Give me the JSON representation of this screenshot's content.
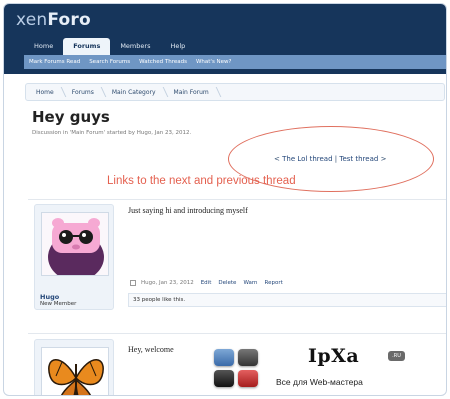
{
  "header": {
    "logo_light": "xen",
    "logo_bold": "Foro"
  },
  "nav": {
    "tabs": [
      "Home",
      "Forums",
      "Members",
      "Help"
    ],
    "active_tab": "Forums"
  },
  "subnav": {
    "items": [
      "Mark Forums Read",
      "Search Forums",
      "Watched Threads",
      "What's New?"
    ]
  },
  "breadcrumb": [
    "Home",
    "Forums",
    "Main Category",
    "Main Forum"
  ],
  "thread": {
    "title": "Hey guys",
    "meta": "Discussion in 'Main Forum' started by Hugo, Jan 23, 2012."
  },
  "thread_nav": {
    "prev_marker": "<",
    "prev_label": "The Lol thread",
    "separator": "|",
    "next_label": "Test thread",
    "next_marker": ">"
  },
  "annotation": "Links to the next and previous thread",
  "posts": [
    {
      "username": "Hugo",
      "user_title": "New Member",
      "text": "Just saying hi and introducing myself",
      "meta_author_date": "Hugo, Jan 23, 2012",
      "actions": [
        "Edit",
        "Delete",
        "Warn",
        "Report"
      ],
      "likes": "33 people like this."
    },
    {
      "text": "Hey, welcome"
    }
  ],
  "watermark": {
    "brand": "IpXa",
    "tld": ".RU",
    "tagline": "Все для Web-мастера"
  },
  "colors": {
    "header_bg": "#16355b",
    "subnav_bg": "#6f96c4",
    "link": "#24477a",
    "annotation": "#e4604f"
  }
}
